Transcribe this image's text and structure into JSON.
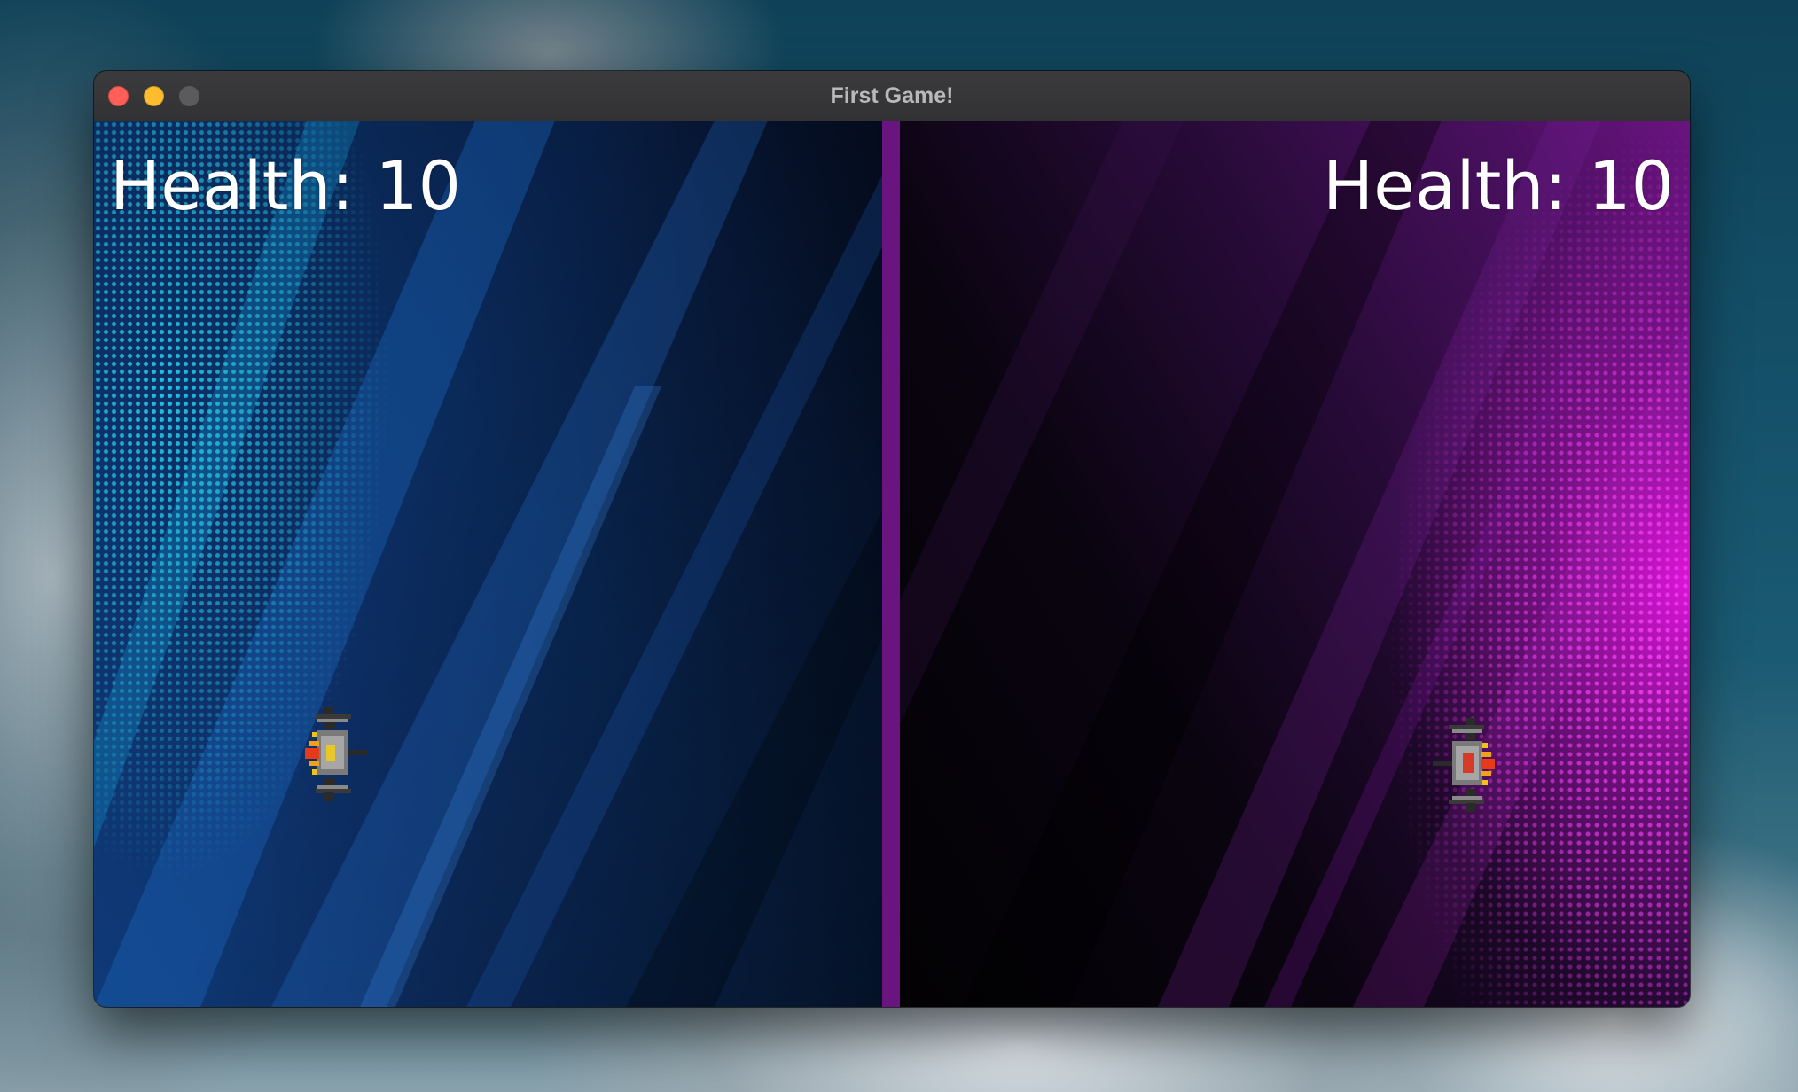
{
  "window": {
    "title": "First Game!"
  },
  "game": {
    "left_player": {
      "health_label": "Health: 10",
      "health": 10,
      "background_color": "#0f3a78"
    },
    "right_player": {
      "health_label": "Health: 10",
      "health": 10,
      "background_color": "#e214dc"
    },
    "border_color": "#6a1480"
  },
  "icons": {
    "left_ship": "yellow-spaceship-icon",
    "right_ship": "red-spaceship-icon"
  }
}
